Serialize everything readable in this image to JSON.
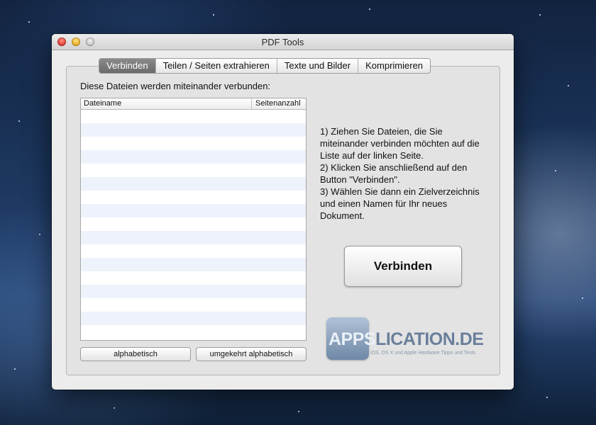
{
  "window": {
    "title": "PDF Tools"
  },
  "tabs": [
    {
      "label": "Verbinden",
      "active": true
    },
    {
      "label": "Teilen / Seiten extrahieren",
      "active": false
    },
    {
      "label": "Texte und Bilder",
      "active": false
    },
    {
      "label": "Komprimieren",
      "active": false
    }
  ],
  "main": {
    "lead": "Diese Dateien werden miteinander verbunden:",
    "table": {
      "columns": [
        "Dateiname",
        "Seitenanzahl"
      ],
      "rows": []
    },
    "sort_buttons": {
      "alphabetic": "alphabetisch",
      "reverse": "umgekehrt alphabetisch"
    },
    "instructions": [
      "1) Ziehen Sie Dateien, die Sie miteinander verbinden möchten auf die Liste auf der linken Seite.",
      "2) Klicken Sie anschließend auf den Button \"Verbinden\".",
      "3) Wählen Sie dann ein Zielverzeichnis und einen Namen für Ihr neues Dokument."
    ],
    "action_button": "Verbinden"
  },
  "watermark": {
    "brand_part1": "APPS",
    "brand_part2": "LICATION.DE",
    "tagline": "iOS, OS X und Apple Hardware Tipps und Tests"
  },
  "colors": {
    "active_tab": "#7a7a7a",
    "row_stripe": "#eef3fb",
    "window_bg": "#ececec"
  }
}
